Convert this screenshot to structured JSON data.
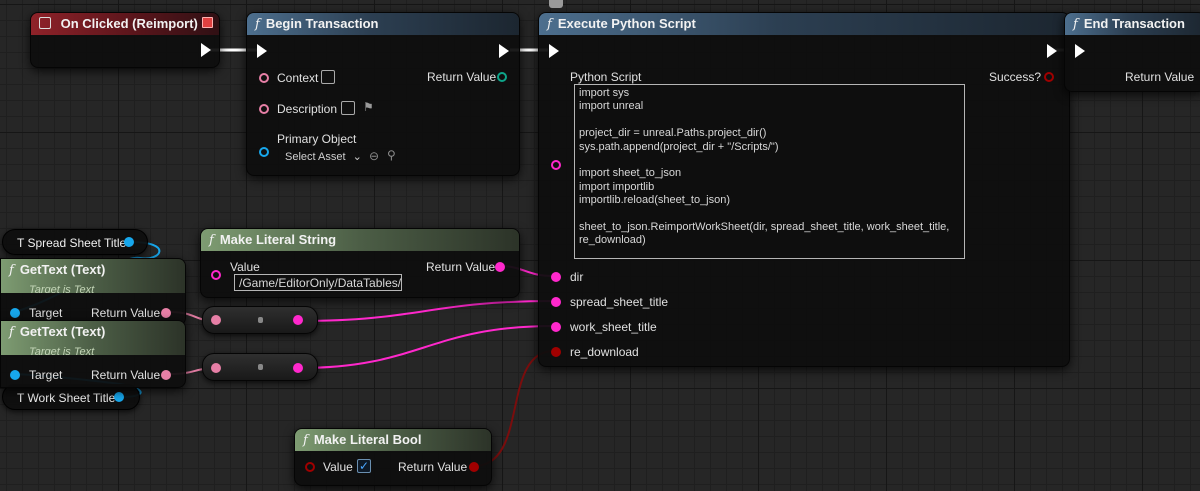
{
  "nodes": {
    "on_clicked": {
      "title": "On Clicked (Reimport)"
    },
    "begin_transaction": {
      "title": "Begin Transaction",
      "pin_context": "Context",
      "pin_description": "Description",
      "pin_primary_object": "Primary Object",
      "select_asset": "Select Asset",
      "pin_return_value": "Return Value"
    },
    "execute_python": {
      "title": "Execute Python Script",
      "pin_python_script": "Python Script",
      "pin_success": "Success?",
      "script_text": "import sys\nimport unreal\n\nproject_dir = unreal.Paths.project_dir()\nsys.path.append(project_dir + \"/Scripts/\")\n\nimport sheet_to_json\nimport importlib\nimportlib.reload(sheet_to_json)\n\nsheet_to_json.ReimportWorkSheet(dir, spread_sheet_title, work_sheet_title,\nre_download)",
      "pin_dir": "dir",
      "pin_spread": "spread_sheet_title",
      "pin_work": "work_sheet_title",
      "pin_redownload": "re_download"
    },
    "end_transaction": {
      "title": "End Transaction",
      "pin_return_value": "Return Value"
    },
    "make_literal_string": {
      "title": "Make Literal String",
      "pin_value": "Value",
      "value": "/Game/EditorOnly/DataTables/",
      "pin_return_value": "Return Value"
    },
    "get_text_1": {
      "title": "GetText (Text)",
      "subtitle": "Target is Text",
      "pin_target": "Target",
      "pin_return_value": "Return Value"
    },
    "get_text_2": {
      "title": "GetText (Text)",
      "subtitle": "Target is Text",
      "pin_target": "Target",
      "pin_return_value": "Return Value"
    },
    "make_literal_bool": {
      "title": "Make Literal Bool",
      "pin_value": "Value",
      "pin_return_value": "Return Value"
    }
  },
  "variables": {
    "spread_sheet_title": "T Spread Sheet Title",
    "work_sheet_title": "T Work Sheet Title"
  },
  "colors": {
    "exec": "#ffffff",
    "string_pin": "#ff28cc",
    "text_pin": "#e77fa6",
    "object_pin": "#17a7ec",
    "bool_pin": "#a00000",
    "struct_pin": "#0ea58a"
  },
  "icons": [
    "function-icon",
    "checkbox-icon",
    "flag-icon",
    "chevron-down-icon",
    "browse-icon",
    "search-icon",
    "comment-bubble-icon"
  ]
}
